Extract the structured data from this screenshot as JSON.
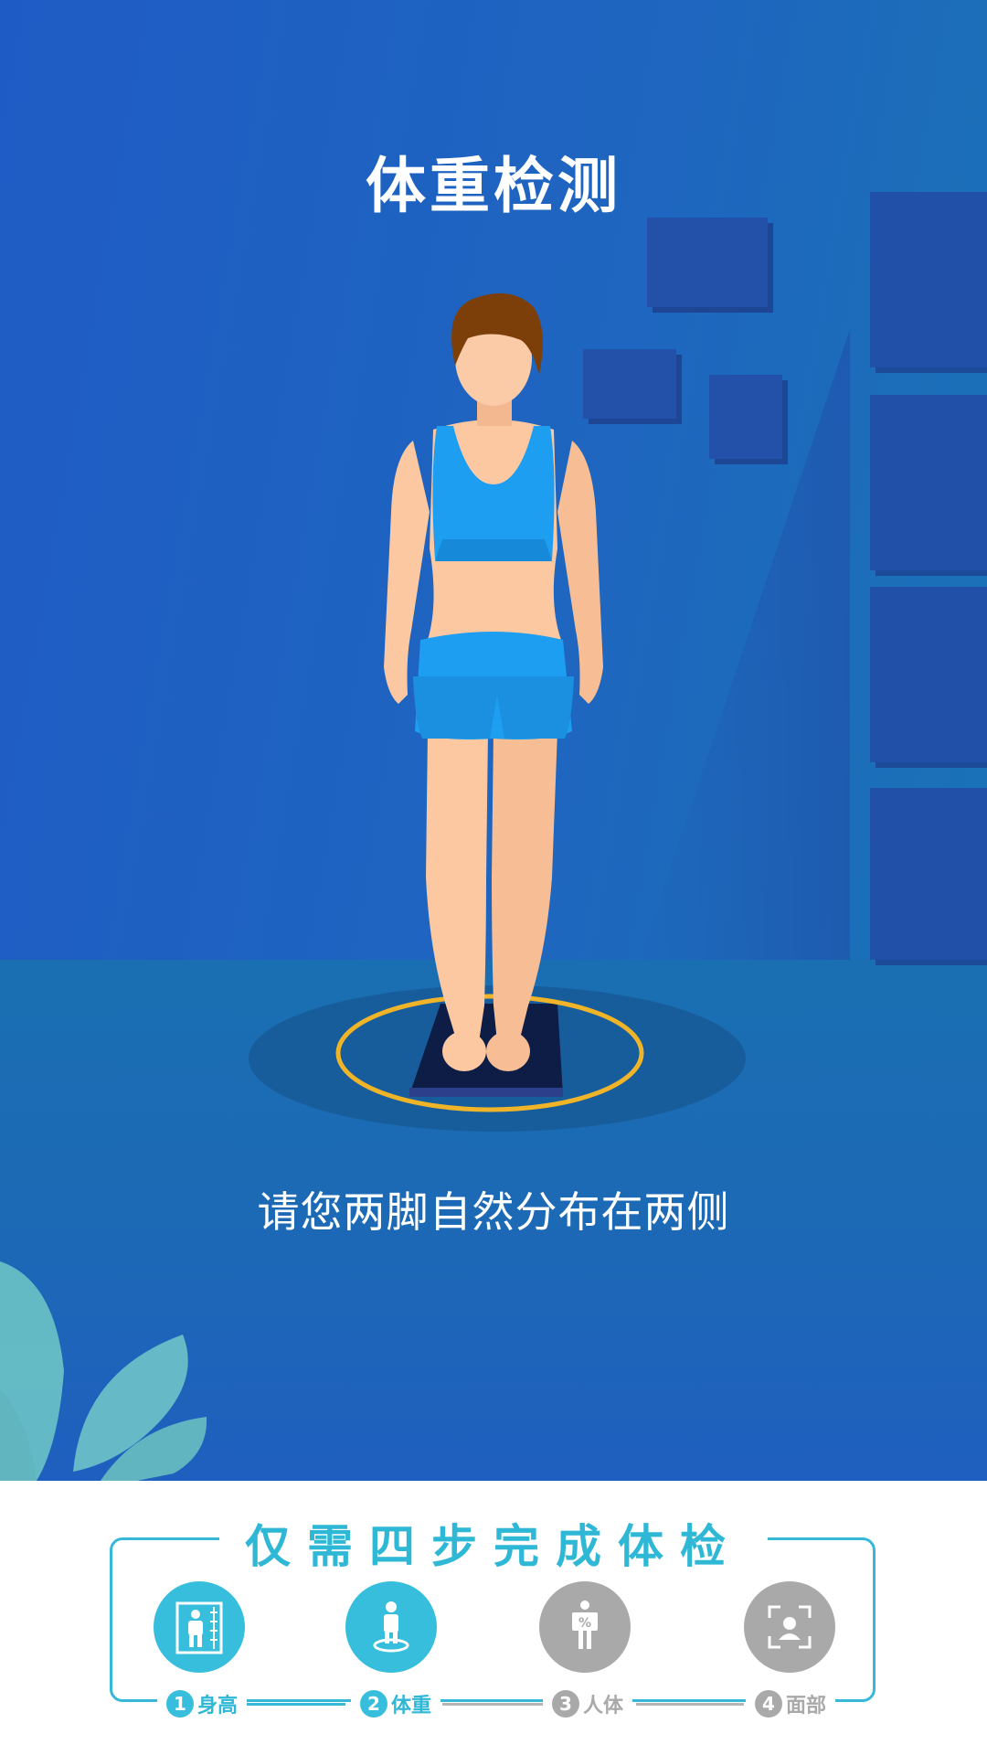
{
  "page": {
    "title": "体重检测",
    "instruction": "请您两脚自然分布在两侧"
  },
  "steps": {
    "title": "仅需四步完成体检",
    "items": [
      {
        "num": "1",
        "label": "身高",
        "icon": "height-ruler-icon",
        "state": "active"
      },
      {
        "num": "2",
        "label": "体重",
        "icon": "weight-scale-icon",
        "state": "active"
      },
      {
        "num": "3",
        "label": "人体",
        "icon": "body-fat-percent-icon",
        "state": "inactive"
      },
      {
        "num": "4",
        "label": "面部",
        "icon": "face-scan-icon",
        "state": "inactive"
      }
    ]
  },
  "colors": {
    "accent": "#36bedc",
    "inactive": "#a9a9a9",
    "background": "#1f5cc4",
    "ring": "#f0b429"
  }
}
